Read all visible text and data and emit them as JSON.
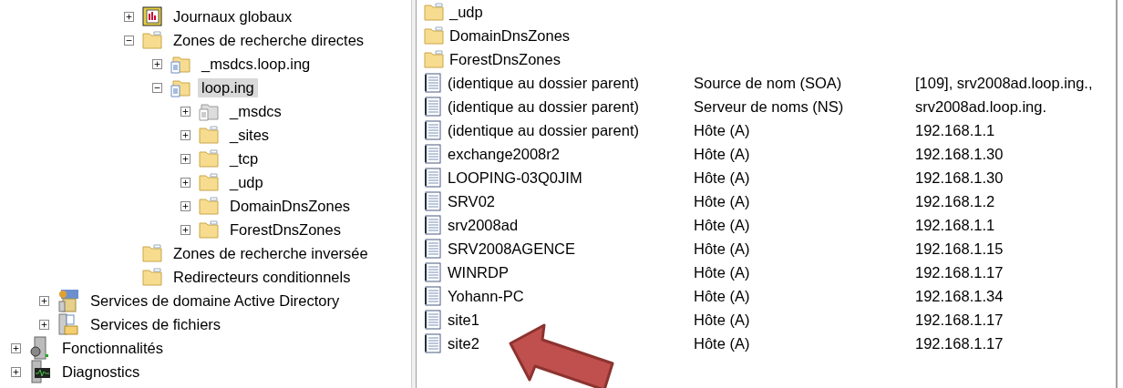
{
  "tree": {
    "dns_items": [
      {
        "label": "Journaux globaux",
        "kind": "journal",
        "expanded": false,
        "selected": false
      },
      {
        "label": "Zones de recherche directes",
        "kind": "folder",
        "expanded": true,
        "selected": false,
        "children": [
          {
            "label": "_msdcs.loop.ing",
            "kind": "zone",
            "expanded": false,
            "selected": false
          },
          {
            "label": "loop.ing",
            "kind": "zone",
            "expanded": true,
            "selected": true,
            "children": [
              {
                "label": "_msdcs",
                "kind": "zone-gray",
                "expanded": false,
                "selected": false
              },
              {
                "label": "_sites",
                "kind": "folder",
                "expanded": false,
                "selected": false
              },
              {
                "label": "_tcp",
                "kind": "folder",
                "expanded": false,
                "selected": false
              },
              {
                "label": "_udp",
                "kind": "folder",
                "expanded": false,
                "selected": false
              },
              {
                "label": "DomainDnsZones",
                "kind": "folder",
                "expanded": false,
                "selected": false
              },
              {
                "label": "ForestDnsZones",
                "kind": "folder",
                "expanded": false,
                "selected": false
              }
            ]
          }
        ]
      },
      {
        "label": "Zones de recherche inversée",
        "kind": "folder",
        "selected": false
      },
      {
        "label": "Redirecteurs conditionnels",
        "kind": "folder",
        "selected": false
      }
    ],
    "role_items": [
      {
        "label": "Services de domaine Active Directory",
        "kind": "directory",
        "expanded": false,
        "selected": false
      },
      {
        "label": "Services de fichiers",
        "kind": "files",
        "expanded": false,
        "selected": false
      }
    ],
    "root_items": [
      {
        "label": "Fonctionnalités",
        "kind": "features",
        "expanded": false,
        "selected": false
      },
      {
        "label": "Diagnostics",
        "kind": "diagnostics",
        "expanded": false,
        "selected": false
      }
    ]
  },
  "list": {
    "rows": [
      {
        "kind": "folder",
        "column_1": "_udp"
      },
      {
        "kind": "folder",
        "column_1": "DomainDnsZones"
      },
      {
        "kind": "folder",
        "column_1": "ForestDnsZones"
      },
      {
        "kind": "record",
        "column_1": "(identique au dossier parent)",
        "column_2": "Source de nom (SOA)",
        "column_3": "[109], srv2008ad.loop.ing.,"
      },
      {
        "kind": "record",
        "column_1": "(identique au dossier parent)",
        "column_2": "Serveur de noms (NS)",
        "column_3": "srv2008ad.loop.ing."
      },
      {
        "kind": "record",
        "column_1": "(identique au dossier parent)",
        "column_2": "Hôte (A)",
        "column_3": "192.168.1.1"
      },
      {
        "kind": "record",
        "column_1": "exchange2008r2",
        "column_2": "Hôte (A)",
        "column_3": "192.168.1.30"
      },
      {
        "kind": "record",
        "column_1": "LOOPING-03Q0JIM",
        "column_2": "Hôte (A)",
        "column_3": "192.168.1.30"
      },
      {
        "kind": "record",
        "column_1": "SRV02",
        "column_2": "Hôte (A)",
        "column_3": "192.168.1.2"
      },
      {
        "kind": "record",
        "column_1": "srv2008ad",
        "column_2": "Hôte (A)",
        "column_3": "192.168.1.1"
      },
      {
        "kind": "record",
        "column_1": "SRV2008AGENCE",
        "column_2": "Hôte (A)",
        "column_3": "192.168.1.15"
      },
      {
        "kind": "record",
        "column_1": "WINRDP",
        "column_2": "Hôte (A)",
        "column_3": "192.168.1.17"
      },
      {
        "kind": "record",
        "column_1": "Yohann-PC",
        "column_2": "Hôte (A)",
        "column_3": "192.168.1.34"
      },
      {
        "kind": "record",
        "column_1": "site1",
        "column_2": "Hôte (A)",
        "column_3": "192.168.1.17"
      },
      {
        "kind": "record",
        "column_1": "site2",
        "column_2": "Hôte (A)",
        "column_3": "192.168.1.17"
      }
    ]
  }
}
